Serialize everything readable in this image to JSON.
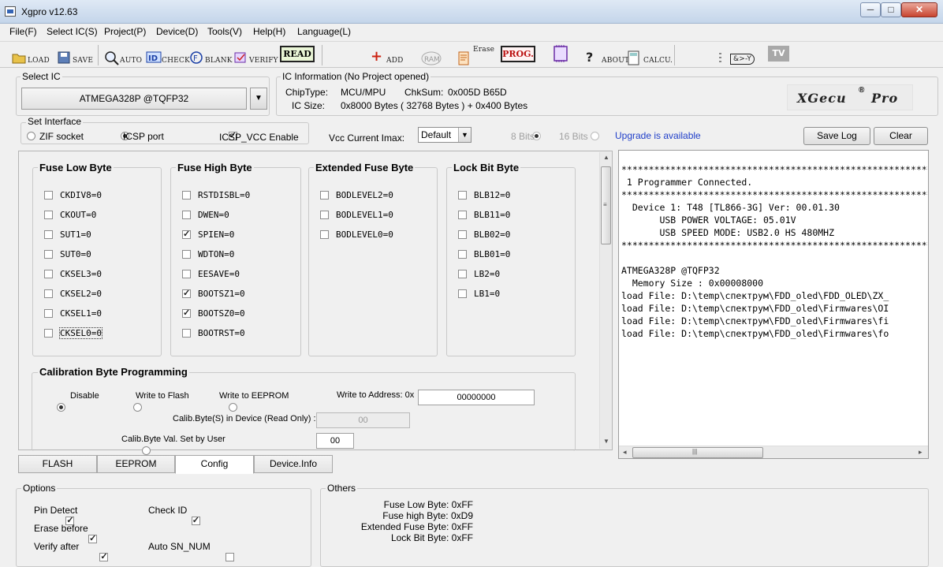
{
  "window": {
    "title": "Xgpro v12.63",
    "min": "─",
    "max": "□",
    "close": "✕"
  },
  "menu": [
    "File(F)",
    "Select IC(S)",
    "Project(P)",
    "Device(D)",
    "Tools(V)",
    "Help(H)",
    "Language(L)"
  ],
  "toolbar": {
    "load": "LOAD",
    "save": "SAVE",
    "auto": "AUTO",
    "check": "CHECK",
    "blank": "BLANK",
    "verify": "VERIFY",
    "read": "READ",
    "add": "ADD",
    "ram": "RAM",
    "erase": "Erase",
    "prog": "PROG.",
    "about": "ABOUT",
    "calcu": "CALCU.",
    "logic": "&>-Y",
    "tv": "TV"
  },
  "select_ic": {
    "title": "Select IC",
    "value": "ATMEGA328P @TQFP32"
  },
  "ic_info": {
    "title": "IC Information (No Project opened)",
    "chiptype_label": "ChipType:",
    "chiptype": "MCU/MPU",
    "chksum_label": "ChkSum:",
    "chksum": "0x005D B65D",
    "size_label": "IC Size:",
    "size": "0x8000 Bytes ( 32768 Bytes ) + 0x400 Bytes",
    "logo": "XGecu",
    "logo_pro": "Pro",
    "logo_reg": "®"
  },
  "interface": {
    "title": "Set Interface",
    "zif": "ZIF socket",
    "icsp": "ICSP port",
    "icsp_vcc": "ICSP_VCC Enable",
    "vcc_label": "Vcc Current Imax:",
    "vcc_value": "Default",
    "bits8": "8 Bits",
    "bits16": "16 Bits",
    "upgrade": "Upgrade is available",
    "savelog": "Save Log",
    "clear": "Clear"
  },
  "fuse_low": {
    "title": "Fuse Low Byte",
    "items": [
      {
        "label": "CKDIV8=0",
        "checked": false
      },
      {
        "label": "CKOUT=0",
        "checked": false
      },
      {
        "label": "SUT1=0",
        "checked": false
      },
      {
        "label": "SUT0=0",
        "checked": false
      },
      {
        "label": "CKSEL3=0",
        "checked": false
      },
      {
        "label": "CKSEL2=0",
        "checked": false
      },
      {
        "label": "CKSEL1=0",
        "checked": false
      },
      {
        "label": "CKSEL0=0",
        "checked": false
      }
    ]
  },
  "fuse_high": {
    "title": "Fuse High Byte",
    "items": [
      {
        "label": "RSTDISBL=0",
        "checked": false
      },
      {
        "label": "DWEN=0",
        "checked": false
      },
      {
        "label": "SPIEN=0",
        "checked": true
      },
      {
        "label": "WDTON=0",
        "checked": false
      },
      {
        "label": "EESAVE=0",
        "checked": false
      },
      {
        "label": "BOOTSZ1=0",
        "checked": true
      },
      {
        "label": "BOOTSZ0=0",
        "checked": true
      },
      {
        "label": "BOOTRST=0",
        "checked": false
      }
    ]
  },
  "fuse_ext": {
    "title": "Extended Fuse Byte",
    "items": [
      {
        "label": "BODLEVEL2=0",
        "checked": false
      },
      {
        "label": "BODLEVEL1=0",
        "checked": false
      },
      {
        "label": "BODLEVEL0=0",
        "checked": false
      }
    ]
  },
  "lock_bits": {
    "title": "Lock Bit Byte",
    "items": [
      {
        "label": "BLB12=0",
        "checked": false
      },
      {
        "label": "BLB11=0",
        "checked": false
      },
      {
        "label": "BLB02=0",
        "checked": false
      },
      {
        "label": "BLB01=0",
        "checked": false
      },
      {
        "label": "LB2=0",
        "checked": false
      },
      {
        "label": "LB1=0",
        "checked": false
      }
    ]
  },
  "calibration": {
    "title": "Calibration Byte Programming",
    "disable": "Disable",
    "write_flash": "Write to Flash",
    "write_eeprom": "Write to EEPROM",
    "write_addr_label": "Write to Address: 0x",
    "write_addr": "00000000",
    "in_device_label": "Calib.Byte(S) in Device (Read Only) :",
    "in_device": "00",
    "set_by_user_label": "Calib.Byte Val. Set by User",
    "set_by_user": "00"
  },
  "tabs": [
    "FLASH",
    "EEPROM",
    "Config",
    "Device.Info"
  ],
  "log": [
    "***********************************************************",
    " 1 Programmer Connected.",
    "***********************************************************",
    "  Device 1: T48 [TL866-3G] Ver: 00.01.30",
    "       USB POWER VOLTAGE: 05.01V",
    "       USB SPEED MODE: USB2.0 HS 480MHZ",
    "***********************************************************",
    "",
    "ATMEGA328P @TQFP32",
    "  Memory Size : 0x00008000",
    "load File: D:\\temp\\спектрум\\FDD_oled\\FDD_OLED\\ZX_",
    "load File: D:\\temp\\спектрум\\FDD_oled\\Firmwares\\OI",
    "load File: D:\\temp\\спектрум\\FDD_oled\\Firmwares\\fi",
    "load File: D:\\temp\\спектрум\\FDD_oled\\Firmwares\\fo"
  ],
  "options": {
    "title": "Options",
    "pin_detect": "Pin Detect",
    "check_id": "Check ID",
    "erase_before": "Erase before",
    "verify_after": "Verify after",
    "auto_sn": "Auto SN_NUM"
  },
  "others": {
    "title": "Others",
    "lines": [
      "Fuse Low Byte: 0xFF",
      "Fuse high Byte: 0xD9",
      "Extended Fuse Byte: 0xFF",
      "Lock Bit Byte: 0xFF"
    ]
  }
}
